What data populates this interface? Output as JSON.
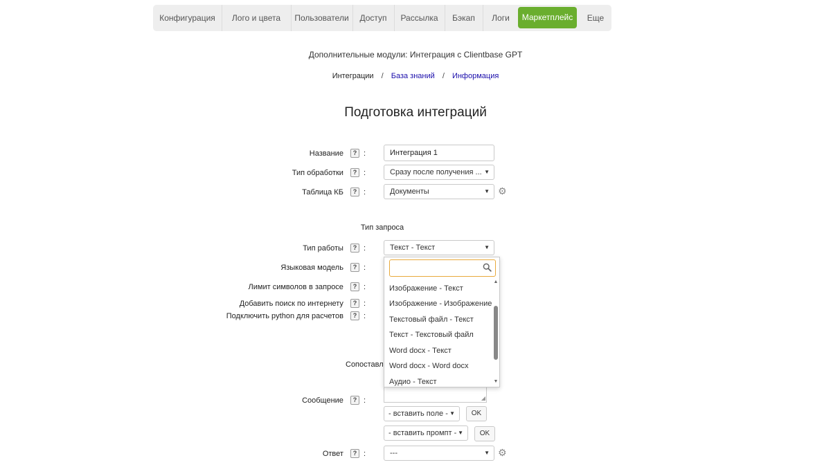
{
  "nav": {
    "items": [
      {
        "label": "Конфигурация"
      },
      {
        "label": "Лого и цвета"
      },
      {
        "label": "Пользователи"
      },
      {
        "label": "Доступ"
      },
      {
        "label": "Рассылка"
      },
      {
        "label": "Бэкап"
      },
      {
        "label": "Логи"
      },
      {
        "label": "Маркетплейс"
      },
      {
        "label": "Еще"
      }
    ],
    "active": "Маркетплейс",
    "active_color": "#6aae2e"
  },
  "subtitle": "Дополнительные модули: Интеграция с Clientbase GPT",
  "breadcrumb": {
    "current": "Интеграции",
    "sep": "/",
    "links": [
      "База знаний",
      "Информация"
    ]
  },
  "page_title": "Подготовка интеграций",
  "form": {
    "name": {
      "label": "Название",
      "value": "Интеграция 1"
    },
    "processing_type": {
      "label": "Тип обработки",
      "value": "Сразу после получения ..."
    },
    "kb_table": {
      "label": "Таблица КБ",
      "value": "Документы"
    },
    "request_type_heading": "Тип запроса",
    "work_type": {
      "label": "Тип работы",
      "value": "Текст - Текст"
    },
    "language_model": {
      "label": "Языковая модель"
    },
    "char_limit": {
      "label": "Лимит символов в запросе"
    },
    "internet_search": {
      "label": "Добавить поиск по интернету"
    },
    "python": {
      "label": "Подключить python для расчетов"
    },
    "mapping_partial": "Сопоставле",
    "message": {
      "label": "Сообщение"
    },
    "insert_field": {
      "value": "- вставить поле -",
      "ok": "OK"
    },
    "insert_prompt": {
      "value": "- вставить промпт -",
      "ok": "OK"
    },
    "answer": {
      "label": "Ответ",
      "value": "---"
    }
  },
  "dropdown": {
    "search_value": "",
    "options": [
      "Изображение - Текст",
      "Изображение - Изображение",
      "Текстовый файл - Текст",
      "Текст - Текстовый файл",
      "Word docx - Текст",
      "Word docx - Word docx",
      "Аудио - Текст"
    ]
  },
  "help_glyph": "?",
  "colon": ":",
  "icons": {
    "gear": "gear-icon",
    "search": "search-icon",
    "caret": "caret-down-icon"
  }
}
